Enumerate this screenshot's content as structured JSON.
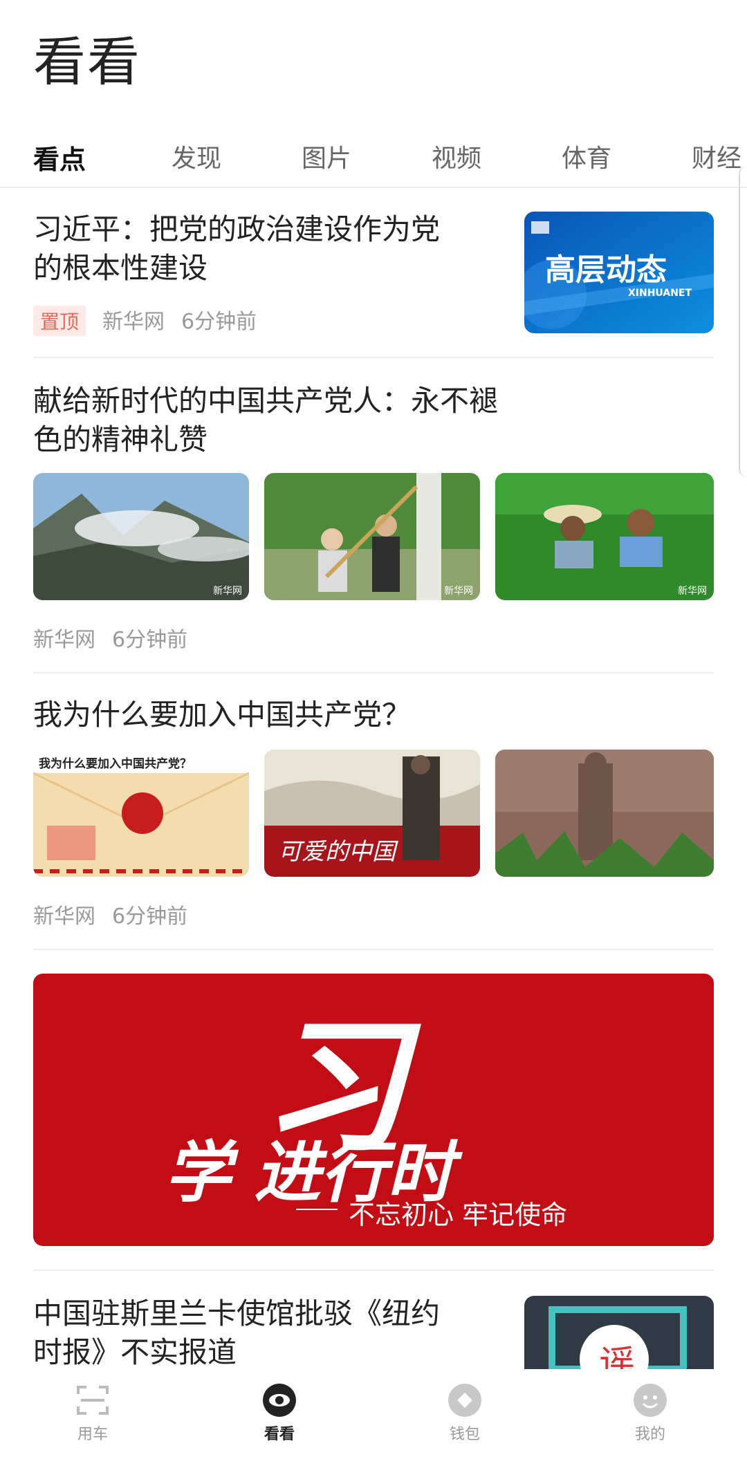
{
  "header": {
    "title": "看看"
  },
  "tabs": [
    {
      "label": "看点",
      "active": true
    },
    {
      "label": "发现"
    },
    {
      "label": "图片"
    },
    {
      "label": "视频"
    },
    {
      "label": "体育"
    },
    {
      "label": "财经"
    }
  ],
  "feed": [
    {
      "title_line1": "习近平：把党的政治建设作为党",
      "title_line2": "的根本性建设",
      "badge": "置顶",
      "source": "新华网",
      "time": "6分钟前",
      "thumb_title": "高层动态",
      "thumb_sub": "XINHUANET"
    },
    {
      "title_line1": "献给新时代的中国共产党人：永不褪",
      "title_line2": "色的精神礼赞",
      "source": "新华网",
      "time": "6分钟前",
      "watermark": "新华网"
    },
    {
      "title_line1": "我为什么要加入中国共产党？",
      "source": "新华网",
      "time": "6分钟前",
      "thumb1_text": "我为什么要加入中国共产党？",
      "thumb2_text": "可爱的中国"
    },
    {
      "banner_main": "学 进行时",
      "banner_big": "习",
      "banner_sub": "不忘初心 牢记使命"
    },
    {
      "title_line1": "中国驻斯里兰卡使馆批驳《纽约",
      "title_line2": "时报》不实报道",
      "thumb_text": "谣"
    }
  ],
  "bottom_nav": [
    {
      "label": "用车",
      "icon": "scan-car-icon"
    },
    {
      "label": "看看",
      "icon": "eye-icon",
      "active": true
    },
    {
      "label": "钱包",
      "icon": "wallet-icon"
    },
    {
      "label": "我的",
      "icon": "smiley-profile-icon"
    }
  ],
  "colors": {
    "accent_dot": "#f7d22a",
    "banner_red": "#c20d14",
    "badge_bg": "#fde9e6",
    "badge_text": "#e9685a"
  }
}
